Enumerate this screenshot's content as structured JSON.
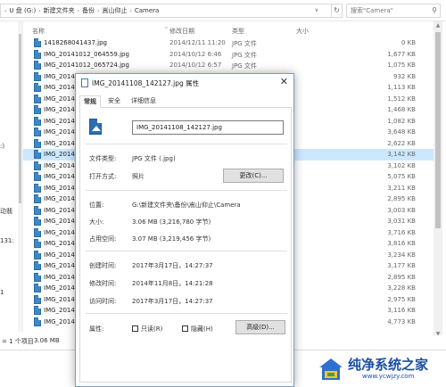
{
  "explorer": {
    "breadcrumb": [
      "U 盘 (G:)",
      "新建文件夹",
      "备份",
      "嵩山仰止",
      "Camera"
    ],
    "search_placeholder": "搜索\"Camera\"",
    "columns": {
      "name": "名称",
      "date": "修改日期",
      "type": "类型",
      "size": "大小"
    },
    "nav_fragments": [
      ":)",
      "动翡",
      "131:",
      "1"
    ],
    "status": {
      "items": "= 1 个项目",
      "selected": "3.06 MB"
    },
    "files": [
      {
        "name": "1418268041437.jpg",
        "date": "2014/12/11 11:20",
        "type": "JPG 文件",
        "size": "0 KB"
      },
      {
        "name": "IMG_20141012_064559.jpg",
        "date": "2014/10/12 6:46",
        "type": "JPG 文件",
        "size": "1,677 KB"
      },
      {
        "name": "IMG_20141012_065724.jpg",
        "date": "2014/10/12 6:57",
        "type": "JPG 文件",
        "size": "1,075 KB"
      },
      {
        "name": "IMG_2014",
        "date": "",
        "type": "",
        "size": "932 KB"
      },
      {
        "name": "IMG_2014",
        "date": "",
        "type": "",
        "size": "1,113 KB"
      },
      {
        "name": "IMG_2014",
        "date": "",
        "type": "",
        "size": "1,512 KB"
      },
      {
        "name": "IMG_2014",
        "date": "",
        "type": "",
        "size": "1,468 KB"
      },
      {
        "name": "IMG_2014",
        "date": "",
        "type": "",
        "size": "1,082 KB"
      },
      {
        "name": "IMG_2014",
        "date": "",
        "type": "",
        "size": "3,648 KB"
      },
      {
        "name": "IMG_2014",
        "date": "",
        "type": "",
        "size": "2,622 KB"
      },
      {
        "name": "IMG_2014",
        "date": "",
        "type": "",
        "size": "3,142 KB"
      },
      {
        "name": "IMG_2014",
        "date": "",
        "type": "",
        "size": "3,102 KB"
      },
      {
        "name": "IMG_2014",
        "date": "",
        "type": "",
        "size": "5,075 KB"
      },
      {
        "name": "IMG_2014",
        "date": "",
        "type": "",
        "size": "3,211 KB"
      },
      {
        "name": "IMG_2014",
        "date": "",
        "type": "",
        "size": "2,895 KB"
      },
      {
        "name": "IMG_2014",
        "date": "",
        "type": "",
        "size": "3,003 KB"
      },
      {
        "name": "IMG_2014",
        "date": "",
        "type": "",
        "size": "3,031 KB"
      },
      {
        "name": "IMG_2014",
        "date": "",
        "type": "",
        "size": "3,716 KB"
      },
      {
        "name": "IMG_2014",
        "date": "",
        "type": "",
        "size": "3,816 KB"
      },
      {
        "name": "IMG_2014",
        "date": "",
        "type": "",
        "size": "3,234 KB"
      },
      {
        "name": "IMG_2014",
        "date": "",
        "type": "",
        "size": "3,177 KB"
      },
      {
        "name": "IMG_2014",
        "date": "",
        "type": "",
        "size": "2,895 KB"
      },
      {
        "name": "IMG_2014",
        "date": "",
        "type": "",
        "size": "3,228 KB"
      },
      {
        "name": "IMG_2014",
        "date": "",
        "type": "",
        "size": "2,975 KB"
      },
      {
        "name": "IMG_2014",
        "date": "",
        "type": "",
        "size": "3,116 KB"
      },
      {
        "name": "IMG_2014",
        "date": "",
        "type": "",
        "size": "4,773 KB"
      }
    ],
    "selected_index": 10
  },
  "dialog": {
    "title": "IMG_20141108_142127.jpg 属性",
    "tabs": [
      "常规",
      "安全",
      "详细信息"
    ],
    "filename": "IMG_20141108_142127.jpg",
    "file_type_label": "文件类型:",
    "file_type_value": "JPG 文件 (.jpg)",
    "open_with_label": "打开方式:",
    "open_with_value": "照片",
    "change_button": "更改(C)...",
    "location_label": "位置:",
    "location_value": "G:\\新建文件夹\\备份\\嵩山仰止\\Camera",
    "size_label": "大小:",
    "size_value": "3.06 MB (3,216,780 字节)",
    "disk_size_label": "占用空间:",
    "disk_size_value": "3.07 MB (3,219,456 字节)",
    "created_label": "创建时间:",
    "created_value": "2017年3月17日，14:27:37",
    "modified_label": "修改时间:",
    "modified_value": "2014年11月8日，14:21:28",
    "accessed_label": "访问时间:",
    "accessed_value": "2017年3月17日，14:27:37",
    "attributes_label": "属性:",
    "readonly_label": "只读(R)",
    "hidden_label": "隐藏(H)",
    "advanced_button": "高级(D)..."
  },
  "watermark": {
    "title": "纯净系统之家",
    "url": "www.ycwjzy.com"
  },
  "colors": {
    "selection": "#cce8ff",
    "accent": "#1c4fa3"
  }
}
